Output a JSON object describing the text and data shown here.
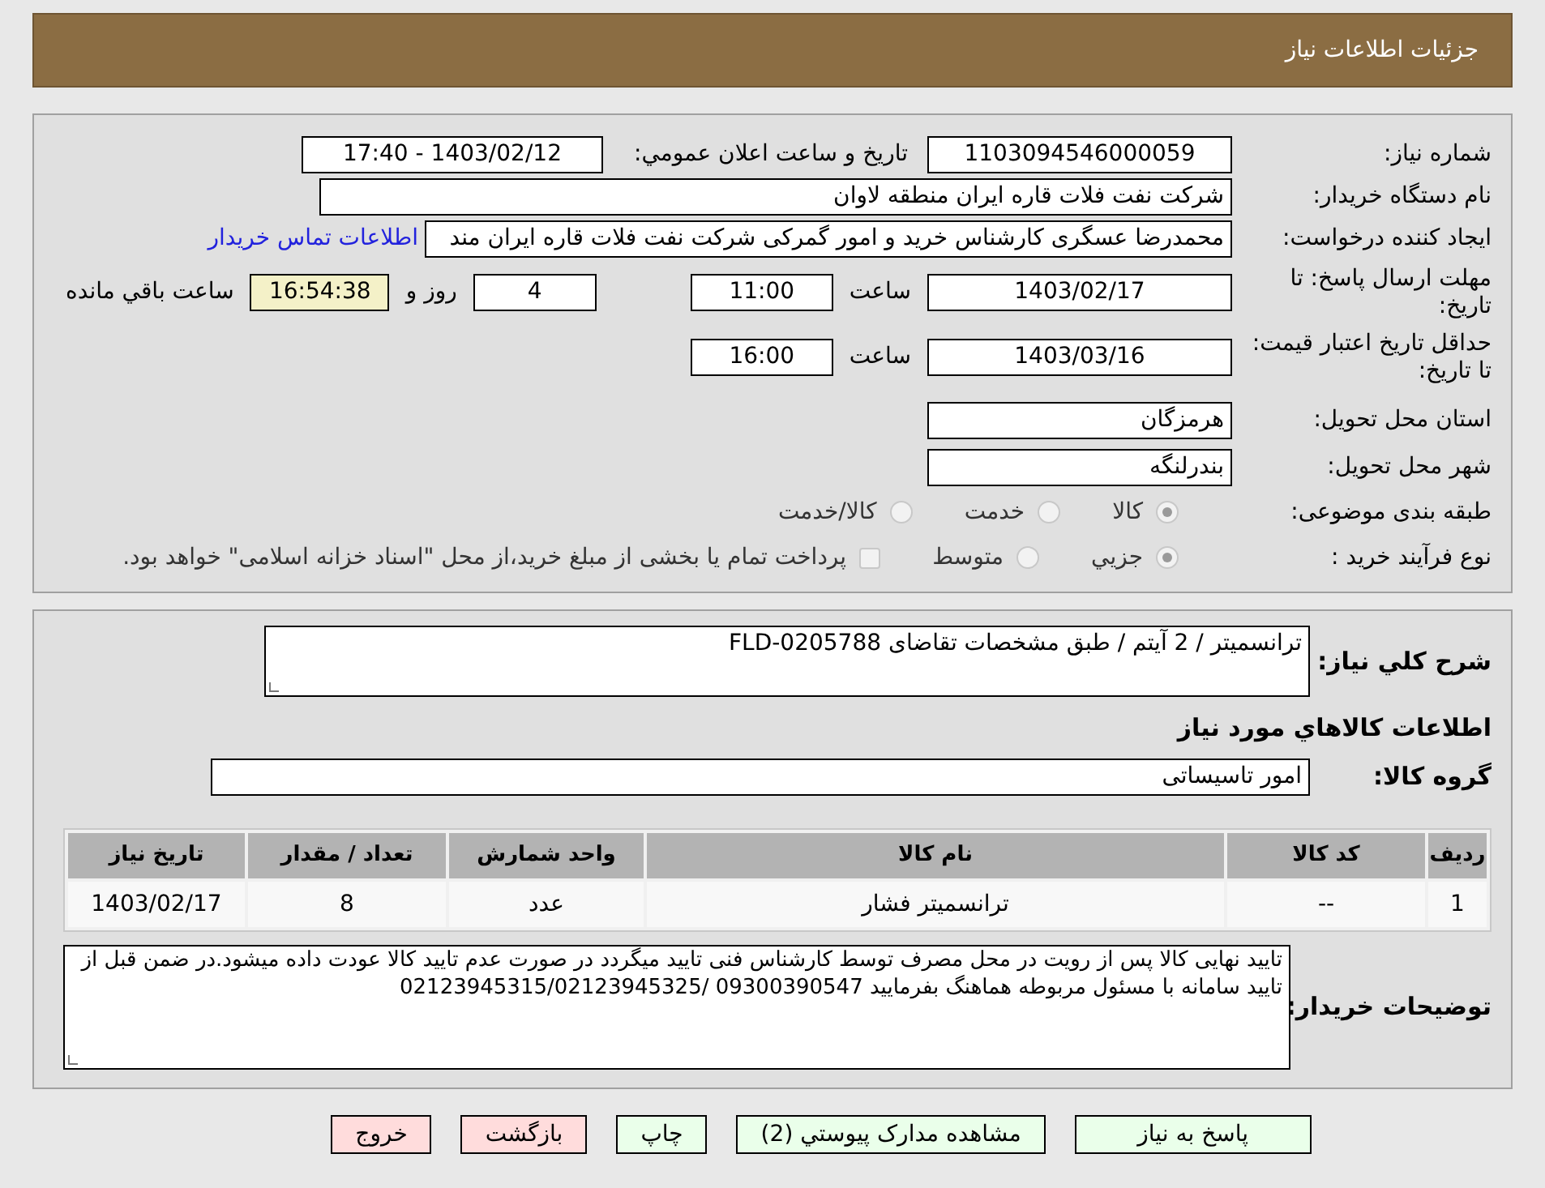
{
  "header": {
    "title": "جزئيات اطلاعات نياز"
  },
  "need_number": {
    "label": "شماره نياز:",
    "value": "1103094546000059"
  },
  "announce": {
    "label": "تاريخ و ساعت اعلان عمومي:",
    "value": "1403/02/12 - 17:40"
  },
  "buyer_org": {
    "label": "نام دستگاه خريدار:",
    "value": "شرکت نفت فلات قاره ايران منطقه لاوان"
  },
  "requester": {
    "label": "ايجاد کننده درخواست:",
    "value": "محمدرضا عسگری کارشناس خرید و امور گمرکی شرکت نفت فلات قاره ایران مند",
    "link": "اطلاعات تماس خريدار"
  },
  "reply_deadline": {
    "label": "مهلت ارسال پاسخ: تا تاريخ:",
    "date": "1403/02/17",
    "time_label": "ساعت",
    "time": "11:00",
    "days": "4",
    "days_label": "روز و",
    "remaining": "16:54:38",
    "remaining_label": "ساعت باقي مانده"
  },
  "price_validity": {
    "label": "حداقل تاريخ اعتبار قيمت: تا تاريخ:",
    "date": "1403/03/16",
    "time_label": "ساعت",
    "time": "16:00"
  },
  "province": {
    "label": "استان محل تحويل:",
    "value": "هرمزگان"
  },
  "city": {
    "label": "شهر محل تحويل:",
    "value": "بندرلنگه"
  },
  "category": {
    "label": "طبقه بندی موضوعی:",
    "options": [
      {
        "label": "کالا",
        "selected": true
      },
      {
        "label": "خدمت",
        "selected": false
      },
      {
        "label": "کالا/خدمت",
        "selected": false
      }
    ]
  },
  "process": {
    "label": "نوع فرآيند خريد :",
    "options": [
      {
        "label": "جزيي",
        "selected": true
      },
      {
        "label": "متوسط",
        "selected": false
      }
    ],
    "checkbox": {
      "checked": false,
      "label": "پرداخت تمام يا بخشی از مبلغ خريد،از محل \"اسناد خزانه اسلامی\" خواهد بود."
    }
  },
  "description": {
    "label": "شرح کلي نياز:",
    "value": "ترانسمیتر / 2 آیتم / طبق مشخصات تقاضای FLD-0205788"
  },
  "goods_heading": "اطلاعات کالاهاي مورد نياز",
  "goods_group": {
    "label": "گروه کالا:",
    "value": "امور تاسیساتی"
  },
  "table": {
    "columns": [
      "رديف",
      "کد کالا",
      "نام کالا",
      "واحد شمارش",
      "تعداد / مقدار",
      "تاريخ نياز"
    ],
    "rows": [
      [
        "1",
        "--",
        "ترانسمیتر فشار",
        "عدد",
        "8",
        "1403/02/17"
      ]
    ]
  },
  "buyer_notes": {
    "label": "توضيحات خريدار:",
    "value": "تایید نهایی کالا پس از رویت در محل مصرف توسط کارشناس فنی تایید میگردد در صورت عدم تایید کالا عودت داده میشود.در ضمن قبل از تایید سامانه با مسئول مربوطه هماهنگ بفرمایید 09300390547 /02123945315/02123945325"
  },
  "buttons": [
    {
      "label": "پاسخ به نياز",
      "kind": "primary"
    },
    {
      "label": "مشاهده مدارک پيوستي (2)",
      "kind": "primary"
    },
    {
      "label": "چاپ",
      "kind": "primary"
    },
    {
      "label": "بازگشت",
      "kind": "danger"
    },
    {
      "label": "خروج",
      "kind": "danger"
    }
  ]
}
